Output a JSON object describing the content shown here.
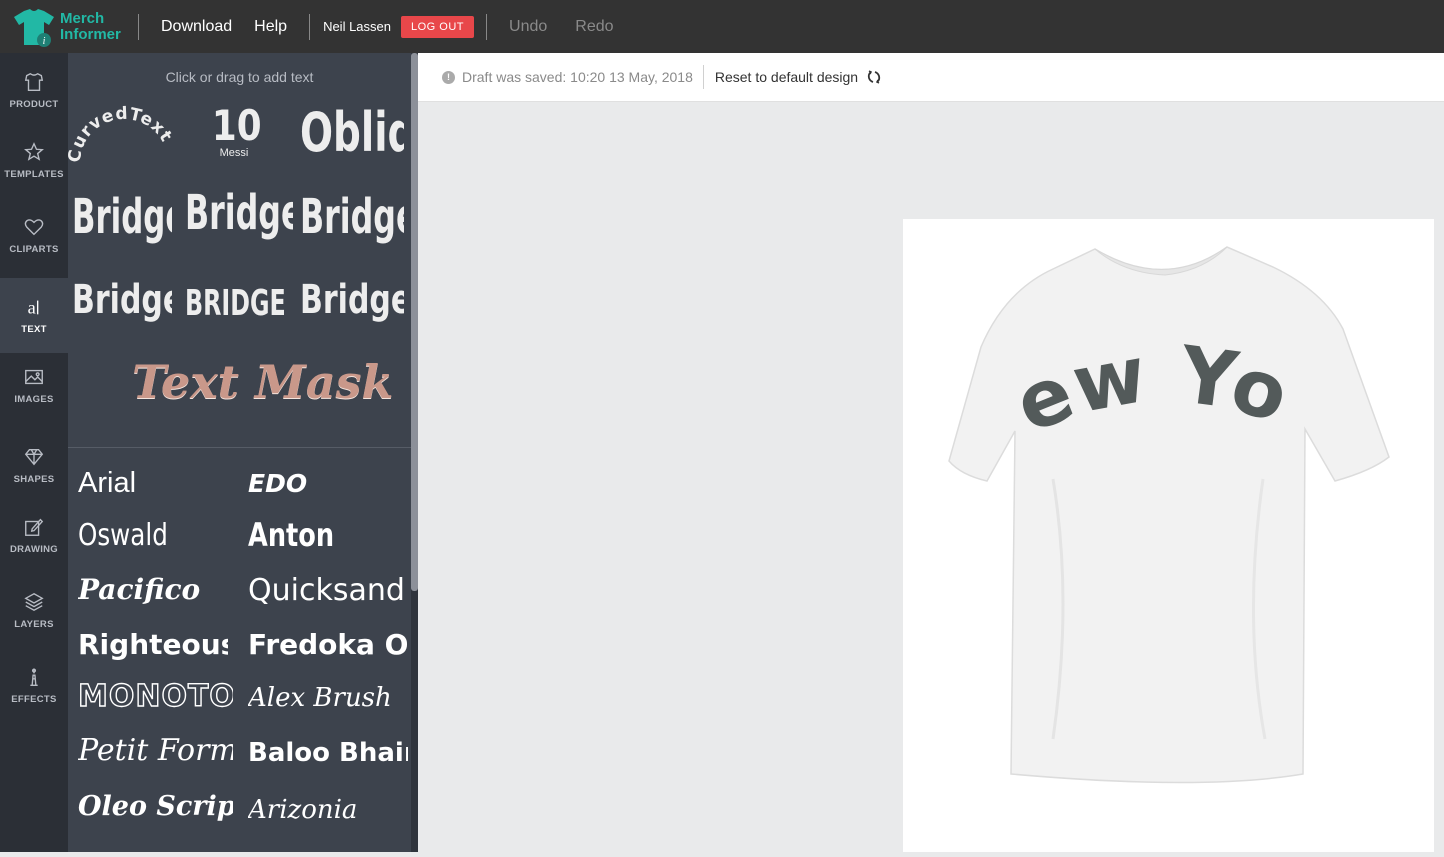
{
  "header": {
    "logo_line1": "Merch",
    "logo_line2": "Informer",
    "download_label": "Download",
    "help_label": "Help",
    "user_name": "Neil Lassen",
    "logout_label": "LOG OUT",
    "undo_label": "Undo",
    "redo_label": "Redo"
  },
  "sidebar": {
    "items": [
      {
        "label": "PRODUCT",
        "icon": "tshirt-icon"
      },
      {
        "label": "TEMPLATES",
        "icon": "star-icon"
      },
      {
        "label": "CLIPARTS",
        "icon": "heart-icon"
      },
      {
        "label": "TEXT",
        "icon": "text-icon"
      },
      {
        "label": "IMAGES",
        "icon": "image-icon"
      },
      {
        "label": "SHAPES",
        "icon": "diamond-icon"
      },
      {
        "label": "DRAWING",
        "icon": "pencil-icon"
      },
      {
        "label": "LAYERS",
        "icon": "layers-icon"
      },
      {
        "label": "EFFECTS",
        "icon": "effects-icon"
      }
    ],
    "active": "TEXT"
  },
  "text_panel": {
    "title": "Click or drag to add text",
    "samples": {
      "curved": "CurvedText",
      "jersey_number": "10",
      "jersey_name": "Messi",
      "oblique": "Oblique",
      "bridge": "Bridge",
      "bridge_caps": "BRIDGE",
      "text_mask": "Text Mask"
    },
    "fonts": [
      "Arial",
      "EDO",
      "Oswald",
      "Anton",
      "Pacifico",
      "Quicksand",
      "Righteous",
      "Fredoka One",
      "Monoton",
      "Alex Brush",
      "Petit Formal",
      "Baloo Bhaina",
      "Oleo Script Swash",
      "Arizonia"
    ]
  },
  "status": {
    "draft_saved": "Draft was saved: 10:20 13 May, 2018",
    "reset_label": "Reset to default design"
  },
  "design": {
    "shirt_text": "New York",
    "shirt_text_color": "#535a5a",
    "shirt_color": "#f2f2f2"
  },
  "colors": {
    "brand": "#22b8a5",
    "logout": "#e8474a",
    "topbar": "#333333",
    "sidebar": "#2b2f36",
    "panel": "#3d434d"
  }
}
